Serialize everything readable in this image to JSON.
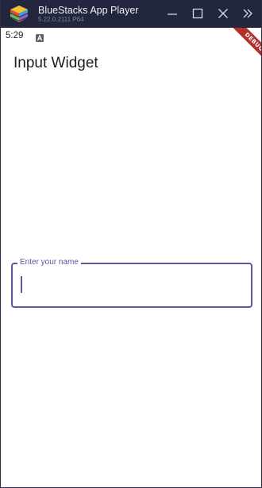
{
  "window": {
    "title": "BlueStacks App Player",
    "version": "5.22.0.2111  P64",
    "controls": {
      "minimize": "minimize-icon",
      "maximize": "maximize-icon",
      "close": "close-icon",
      "sidebar": "double-chevron-right-icon"
    }
  },
  "status_bar": {
    "time": "5:29",
    "notification_icon": "android-a-icon"
  },
  "debug_banner": "DEBUG",
  "app": {
    "title": "Input Widget",
    "name_field": {
      "label": "Enter your name",
      "value": ""
    }
  },
  "colors": {
    "titlebar": "#22263f",
    "accent": "#6751a0",
    "debug_banner": "#b2312b",
    "background": "#ffffff"
  }
}
